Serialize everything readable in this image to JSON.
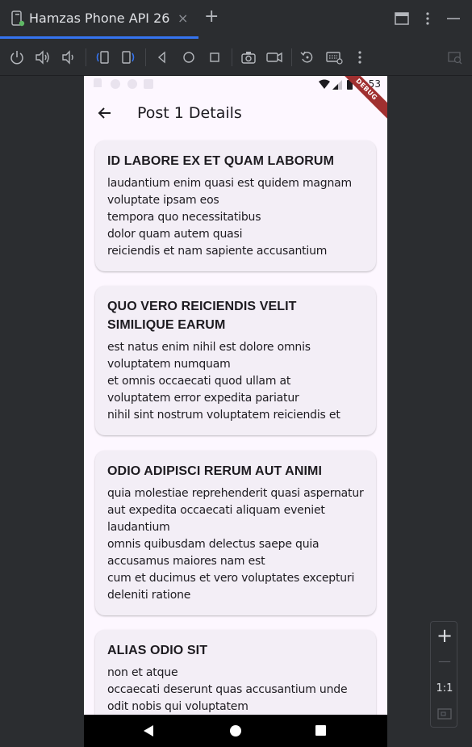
{
  "window": {
    "tab_title": "Hamzas Phone API 26",
    "close_glyph": "×",
    "add_glyph": "+"
  },
  "toolbar": {
    "icons": [
      "power-icon",
      "volume-up-icon",
      "volume-down-icon",
      "rotate-left-icon",
      "rotate-right-icon",
      "back-icon",
      "home-icon",
      "overview-icon",
      "screenshot-icon",
      "screen-record-icon",
      "snapshot-icon",
      "extended-controls-icon",
      "more-icon"
    ]
  },
  "phone": {
    "status_time": "8:53",
    "debug_label": "DEBUG",
    "appbar_title": "Post 1 Details",
    "cards": [
      {
        "title": "ID LABORE EX ET QUAM LABORUM",
        "body": "laudantium enim quasi est quidem magnam voluptate ipsam eos\ntempora quo necessitatibus\ndolor quam autem quasi\nreiciendis et nam sapiente accusantium"
      },
      {
        "title": "QUO VERO REICIENDIS VELIT SIMILIQUE EARUM",
        "body": "est natus enim nihil est dolore omnis voluptatem numquam\net omnis occaecati quod ullam at\nvoluptatem error expedita pariatur\nnihil sint nostrum voluptatem reiciendis et"
      },
      {
        "title": "ODIO ADIPISCI RERUM AUT ANIMI",
        "body": "quia molestiae reprehenderit quasi aspernatur\naut expedita occaecati aliquam eveniet laudantium\nomnis quibusdam delectus saepe quia accusamus maiores nam est\ncum et ducimus et vero voluptates excepturi deleniti ratione"
      },
      {
        "title": "ALIAS ODIO SIT",
        "body": "non et atque\noccaecati deserunt quas accusantium unde odit nobis qui voluptatem"
      }
    ]
  },
  "zoom": {
    "plus": "+",
    "minus": "—",
    "one_to_one": "1:1"
  },
  "colors": {
    "accent": "#3574f0",
    "phone_background": "#fdf7ff",
    "card_background": "#f3eef6",
    "ide_background": "#2b2d30"
  }
}
